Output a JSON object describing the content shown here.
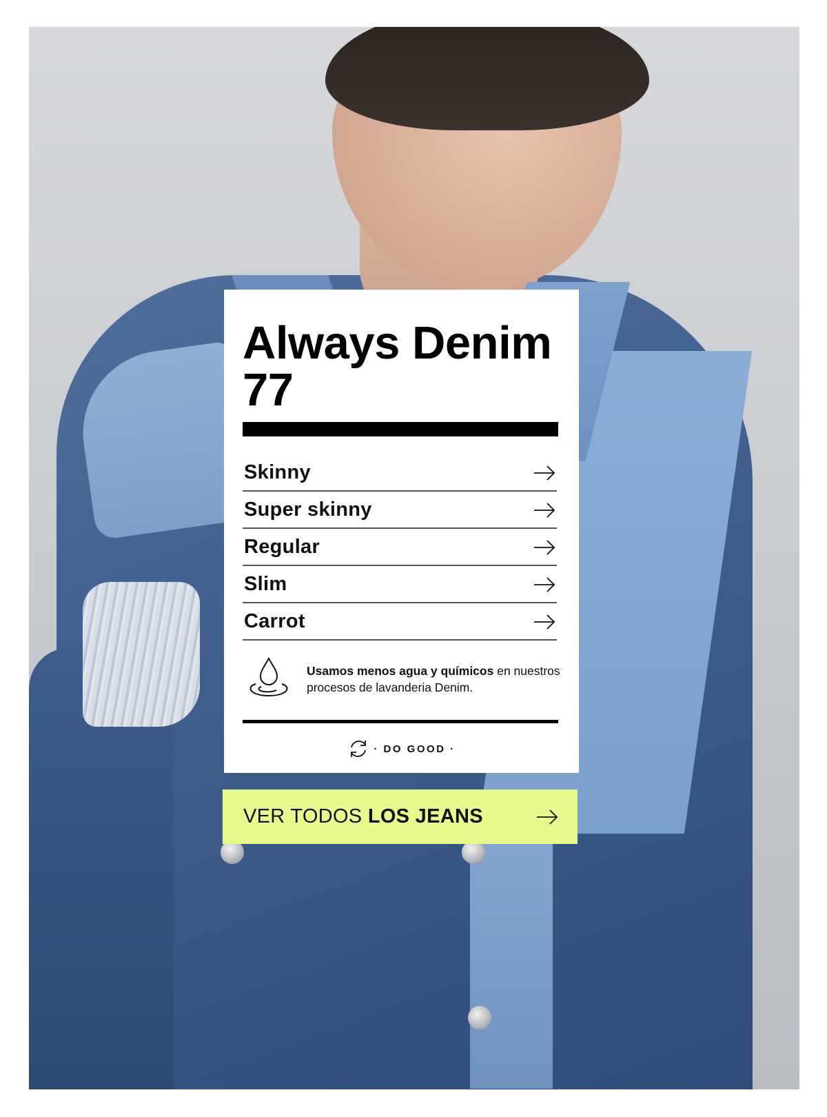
{
  "card": {
    "title_line1": "Always Denim",
    "title_line2": "77",
    "fits": [
      {
        "label": "Skinny",
        "icon": "arrow-right-icon"
      },
      {
        "label": "Super skinny",
        "icon": "arrow-right-icon"
      },
      {
        "label": "Regular",
        "icon": "arrow-right-icon"
      },
      {
        "label": "Slim",
        "icon": "arrow-right-icon"
      },
      {
        "label": "Carrot",
        "icon": "arrow-right-icon"
      }
    ],
    "info": {
      "icon": "water-drop-icon",
      "bold": "Usamos menos agua y químicos",
      "rest": " en nuestros procesos de lavanderia Denim."
    },
    "logo": {
      "icon": "recycle-arrows-icon",
      "text": "· DO GOOD ·"
    }
  },
  "cta": {
    "light": "VER TODOS ",
    "bold": "LOS JEANS",
    "icon": "arrow-right-icon",
    "background": "#e6fb8c"
  },
  "colors": {
    "text": "#111111",
    "card": "#ffffff",
    "accent": "#e6fb8c"
  }
}
